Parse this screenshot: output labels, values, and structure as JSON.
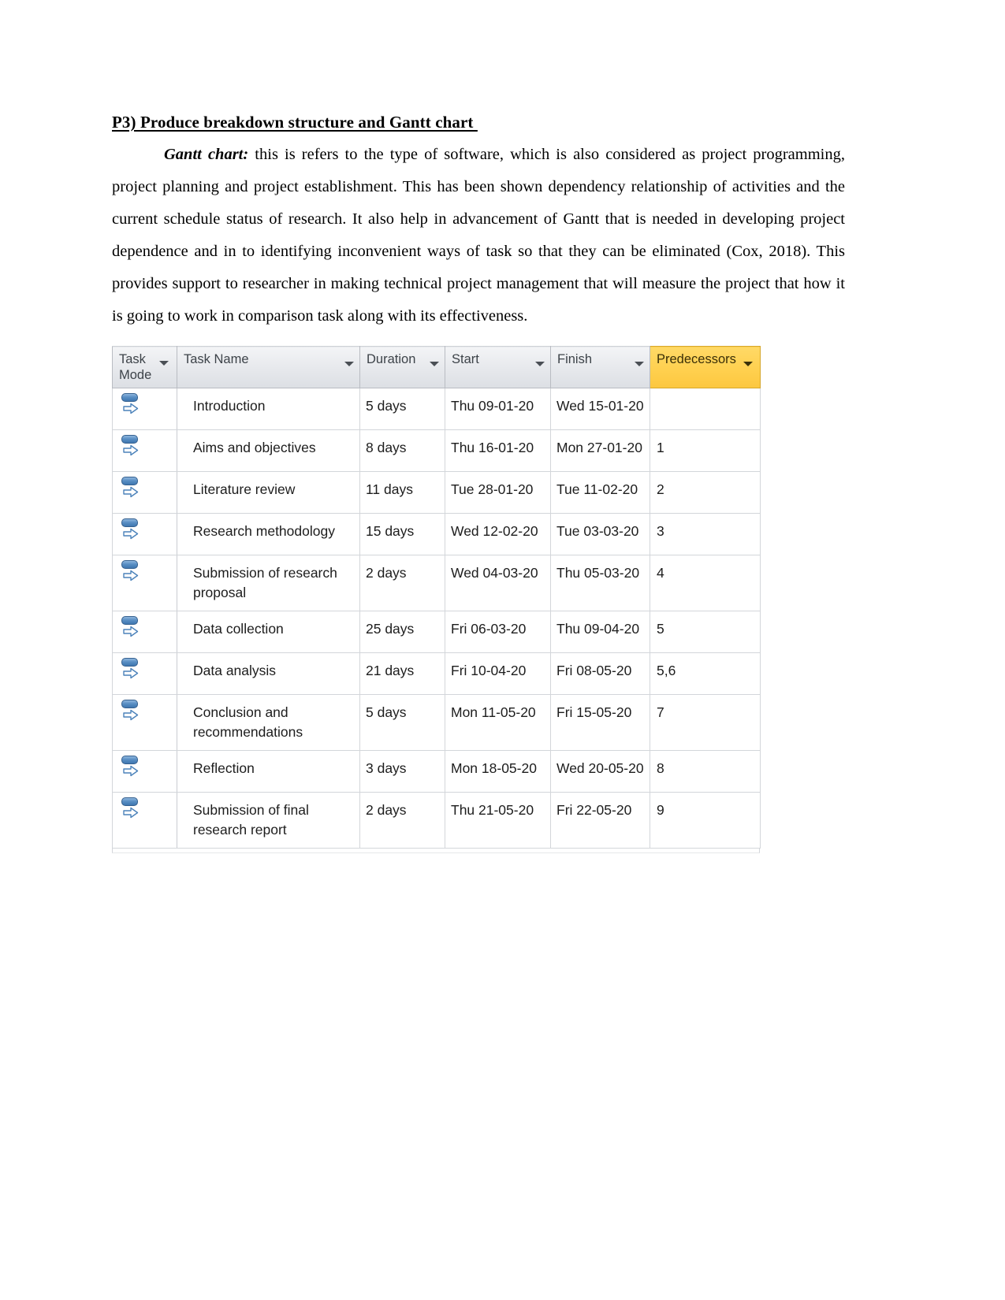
{
  "document": {
    "heading": "P3) Produce breakdown structure and Gantt chart ",
    "paragraph_lead": "Gantt chart:",
    "paragraph_body": " this is refers to the type of software, which is also considered as project programming, project planning and project establishment. This has been shown dependency relationship of activities and the current schedule status of research. It also help in advancement of Gantt that is needed in developing project dependence and in to identifying inconvenient ways of task so that they can be eliminated (Cox, 2018). This provides support to researcher in making technical project management that will measure the project that how it is going to work in comparison task along with its effectiveness."
  },
  "gantt_table": {
    "highlight_color": "#ffcf4d",
    "header_color": "#e6e8ec",
    "columns": [
      {
        "key": "task_mode",
        "label_line1": "Task",
        "label_line2": "Mode",
        "highlighted": false
      },
      {
        "key": "task_name",
        "label_line1": "Task Name",
        "label_line2": "",
        "highlighted": false
      },
      {
        "key": "duration",
        "label_line1": "Duration",
        "label_line2": "",
        "highlighted": false
      },
      {
        "key": "start",
        "label_line1": "Start",
        "label_line2": "",
        "highlighted": false
      },
      {
        "key": "finish",
        "label_line1": "Finish",
        "label_line2": "",
        "highlighted": false
      },
      {
        "key": "predecessors",
        "label_line1": "Predecessors",
        "label_line2": "",
        "highlighted": true
      }
    ],
    "rows": [
      {
        "mode_icon": "auto-scheduled-icon",
        "task_name": "Introduction",
        "duration": "5 days",
        "start": "Thu 09-01-20",
        "finish": "Wed 15-01-20",
        "predecessors": ""
      },
      {
        "mode_icon": "auto-scheduled-icon",
        "task_name": "Aims and objectives",
        "duration": "8 days",
        "start": "Thu 16-01-20",
        "finish": "Mon 27-01-20",
        "predecessors": "1"
      },
      {
        "mode_icon": "auto-scheduled-icon",
        "task_name": "Literature review",
        "duration": "11 days",
        "start": "Tue 28-01-20",
        "finish": "Tue 11-02-20",
        "predecessors": "2"
      },
      {
        "mode_icon": "auto-scheduled-icon",
        "task_name": "Research methodology",
        "duration": "15 days",
        "start": "Wed 12-02-20",
        "finish": "Tue 03-03-20",
        "predecessors": "3"
      },
      {
        "mode_icon": "auto-scheduled-icon",
        "task_name": "Submission of research proposal",
        "duration": "2 days",
        "start": "Wed 04-03-20",
        "finish": "Thu 05-03-20",
        "predecessors": "4"
      },
      {
        "mode_icon": "auto-scheduled-icon",
        "task_name": "Data collection",
        "duration": "25 days",
        "start": "Fri 06-03-20",
        "finish": "Thu 09-04-20",
        "predecessors": "5"
      },
      {
        "mode_icon": "auto-scheduled-icon",
        "task_name": "Data analysis",
        "duration": "21 days",
        "start": "Fri 10-04-20",
        "finish": "Fri 08-05-20",
        "predecessors": "5,6"
      },
      {
        "mode_icon": "auto-scheduled-icon",
        "task_name": "Conclusion and recommendations",
        "duration": "5 days",
        "start": "Mon 11-05-20",
        "finish": "Fri 15-05-20",
        "predecessors": "7"
      },
      {
        "mode_icon": "auto-scheduled-icon",
        "task_name": "Reflection",
        "duration": "3 days",
        "start": "Mon 18-05-20",
        "finish": "Wed 20-05-20",
        "predecessors": "8"
      },
      {
        "mode_icon": "auto-scheduled-icon",
        "task_name": "Submission of final research report",
        "duration": "2 days",
        "start": "Thu 21-05-20",
        "finish": "Fri 22-05-20",
        "predecessors": "9"
      }
    ]
  }
}
